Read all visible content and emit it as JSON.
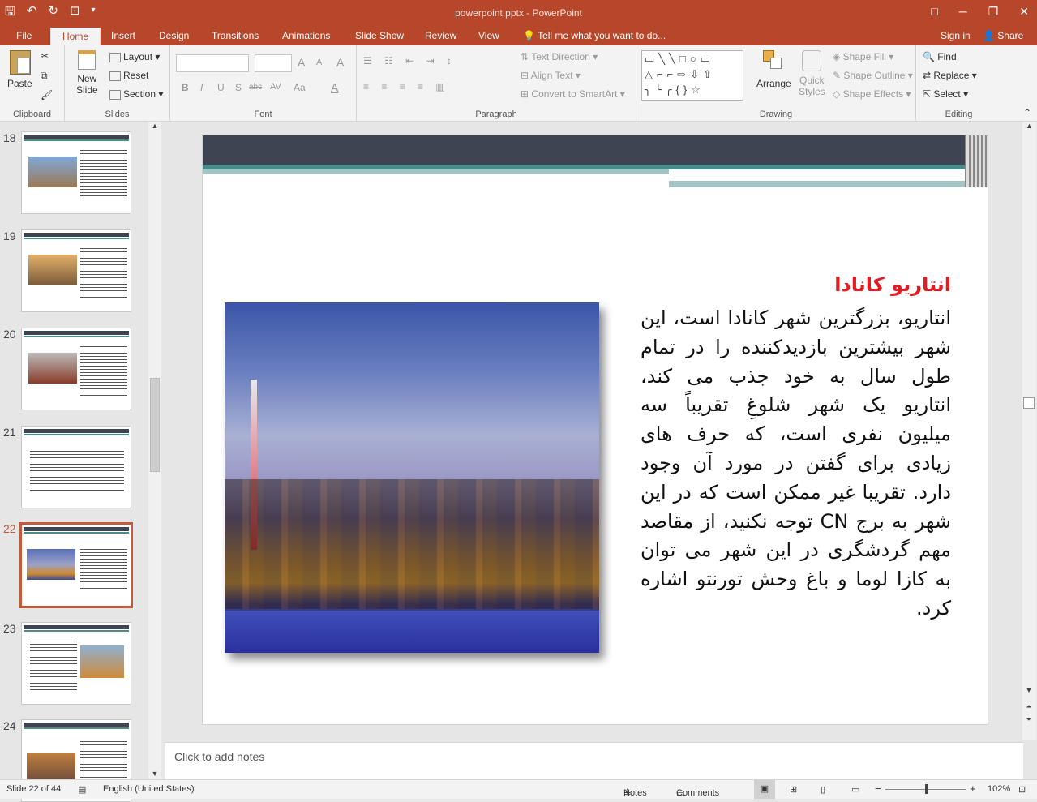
{
  "app": {
    "window_title": "powerpoint.pptx - PowerPoint",
    "window_controls": {
      "restore_ribbon": "□",
      "minimize": "─",
      "maximize": "❐",
      "close": "✕"
    }
  },
  "tabs": [
    {
      "label": "File"
    },
    {
      "label": "Home"
    },
    {
      "label": "Insert"
    },
    {
      "label": "Design"
    },
    {
      "label": "Transitions"
    },
    {
      "label": "Animations"
    },
    {
      "label": "Slide Show"
    },
    {
      "label": "Review"
    },
    {
      "label": "View"
    }
  ],
  "tell_me": "Tell me what you want to do...",
  "account": {
    "signin": "Sign in",
    "share": "Share"
  },
  "ribbon": {
    "clipboard": {
      "label": "Clipboard",
      "paste": "Paste"
    },
    "slides": {
      "label": "Slides",
      "new_slide_1": "New",
      "new_slide_2": "Slide",
      "layout": "Layout",
      "reset": "Reset",
      "section": "Section"
    },
    "font": {
      "label": "Font",
      "bold": "B",
      "italic": "I",
      "underline": "U",
      "shadow": "S",
      "strike": "abc",
      "spacing": "AV",
      "case": "Aa",
      "grow": "A",
      "shrink": "A",
      "clear": "A",
      "color": "A"
    },
    "paragraph": {
      "label": "Paragraph",
      "text_direction": "Text Direction",
      "align_text": "Align Text",
      "convert_smartart": "Convert to SmartArt"
    },
    "drawing": {
      "label": "Drawing",
      "arrange": "Arrange",
      "quick_styles_1": "Quick",
      "quick_styles_2": "Styles",
      "shape_fill": "Shape Fill",
      "shape_outline": "Shape Outline",
      "shape_effects": "Shape Effects"
    },
    "editing": {
      "label": "Editing",
      "find": "Find",
      "replace": "Replace",
      "select": "Select"
    }
  },
  "thumbnails": [
    {
      "num": "18",
      "selected": false
    },
    {
      "num": "19",
      "selected": false
    },
    {
      "num": "20",
      "selected": false
    },
    {
      "num": "21",
      "selected": false
    },
    {
      "num": "22",
      "selected": true
    },
    {
      "num": "23",
      "selected": false
    },
    {
      "num": "24",
      "selected": false
    }
  ],
  "slide": {
    "heading": "انتاریو کانادا",
    "body": "انتاریو، بزرگترین شهر کانادا است، این شهر بیشترین بازدیدکننده را در تمام طول سال به خود جذب می کند، انتاریو یک شهر شلوغِ تقریباً سه میلیون نفری است، که حرف های زیادی برای گفتن در مورد آن وجود دارد. تقریبا غیر ممکن است که در این شهر به برج  CN توجه نکنید، از مقاصد مهم گردشگری در این شهر می توان به کازا لوما و باغ وحش تورنتو اشاره کرد.",
    "heading_color": "#e31b23",
    "accent_dark": "#3f4452",
    "accent_teal": "#4a8c8c"
  },
  "notes_placeholder": "Click to add notes",
  "status": {
    "slide_info": "Slide 22 of 44",
    "language": "English (United States)",
    "notes": "Notes",
    "comments": "Comments",
    "zoom": "102%",
    "zoom_minus": "−",
    "zoom_plus": "+"
  }
}
